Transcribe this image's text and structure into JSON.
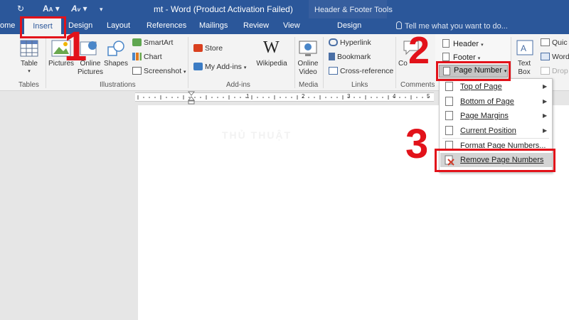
{
  "window": {
    "title": "mt - Word (Product Activation Failed)",
    "contextual_group": "Header & Footer Tools"
  },
  "tabs": {
    "home": "ome",
    "insert": "Insert",
    "design": "Design",
    "layout": "Layout",
    "references": "References",
    "mailings": "Mailings",
    "review": "Review",
    "view": "View",
    "hf_design": "Design"
  },
  "tell_me": "Tell me what you want to do...",
  "ribbon": {
    "tables": {
      "table": "Table",
      "group": "Tables"
    },
    "illustrations": {
      "pictures": "Pictures",
      "online_pictures": "Online Pictures",
      "shapes": "Shapes",
      "smartart": "SmartArt",
      "chart": "Chart",
      "screenshot": "Screenshot",
      "group": "Illustrations"
    },
    "addins": {
      "store": "Store",
      "my_addins": "My Add-ins",
      "wikipedia": "Wikipedia",
      "group": "Add-ins"
    },
    "media": {
      "online_video": "Online Video",
      "group": "Media"
    },
    "links": {
      "hyperlink": "Hyperlink",
      "bookmark": "Bookmark",
      "cross_reference": "Cross-reference",
      "group": "Links"
    },
    "comments": {
      "comment": "Co",
      "group": "Comments"
    },
    "header_footer": {
      "header": "Header",
      "footer": "Footer",
      "page_number": "Page Number"
    },
    "text": {
      "text_box": "Text Box",
      "quick": "Quic",
      "word": "Word",
      "drop": "Drop"
    }
  },
  "ruler": {
    "labels": [
      "1",
      "2",
      "3",
      "4",
      "5"
    ]
  },
  "page_number_menu": {
    "items": [
      {
        "label": "Top of Page",
        "submenu": true
      },
      {
        "label": "Bottom of Page",
        "submenu": true
      },
      {
        "label": "Page Margins",
        "submenu": true
      },
      {
        "label": "Current Position",
        "submenu": true
      },
      {
        "label": "Format Page Numbers...",
        "submenu": false
      },
      {
        "label": "Remove Page Numbers",
        "submenu": false
      }
    ]
  },
  "steps": {
    "one": "1",
    "two": "2",
    "three": "3"
  },
  "watermark": "THỦ THUẬT",
  "colors": {
    "word_blue": "#2b579a",
    "annotation_red": "#e2121a"
  }
}
